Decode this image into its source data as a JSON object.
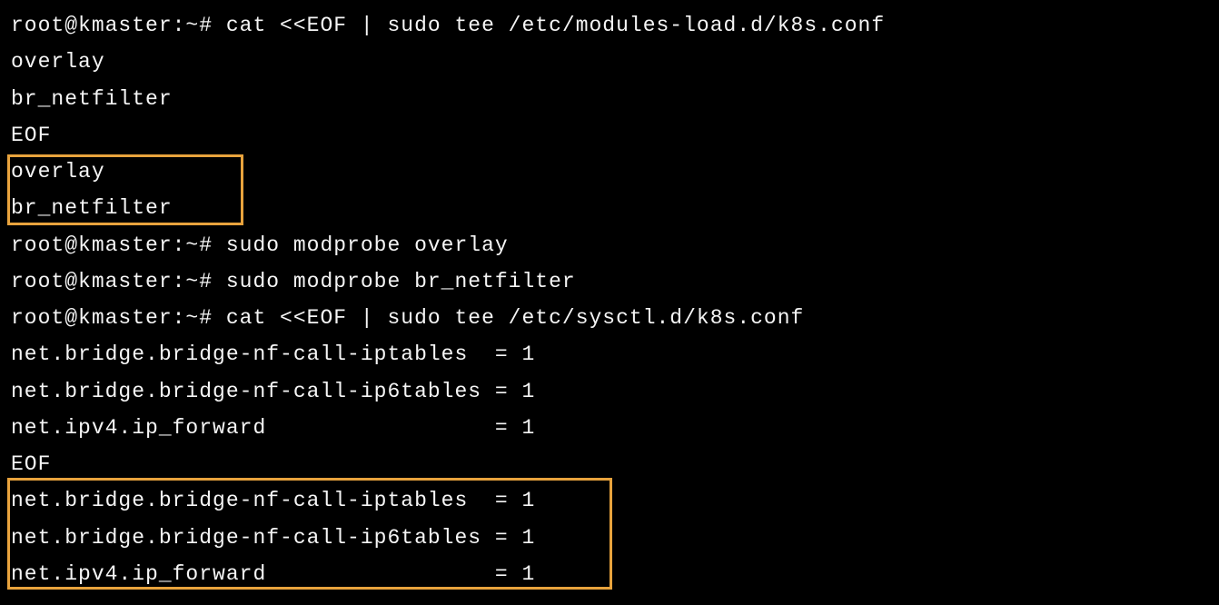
{
  "terminal": {
    "prompt": "root@kmaster:~# ",
    "lines": [
      "root@kmaster:~# cat <<EOF | sudo tee /etc/modules-load.d/k8s.conf",
      "overlay",
      "br_netfilter",
      "EOF",
      "overlay",
      "br_netfilter",
      "root@kmaster:~# sudo modprobe overlay",
      "root@kmaster:~# sudo modprobe br_netfilter",
      "root@kmaster:~# cat <<EOF | sudo tee /etc/sysctl.d/k8s.conf",
      "net.bridge.bridge-nf-call-iptables  = 1",
      "net.bridge.bridge-nf-call-ip6tables = 1",
      "net.ipv4.ip_forward                 = 1",
      "EOF",
      "net.bridge.bridge-nf-call-iptables  = 1",
      "net.bridge.bridge-nf-call-ip6tables = 1",
      "net.ipv4.ip_forward                 = 1"
    ],
    "highlights": [
      {
        "startLine": 4,
        "endLine": 5,
        "description": "modules-output"
      },
      {
        "startLine": 13,
        "endLine": 15,
        "description": "sysctl-output"
      }
    ]
  }
}
